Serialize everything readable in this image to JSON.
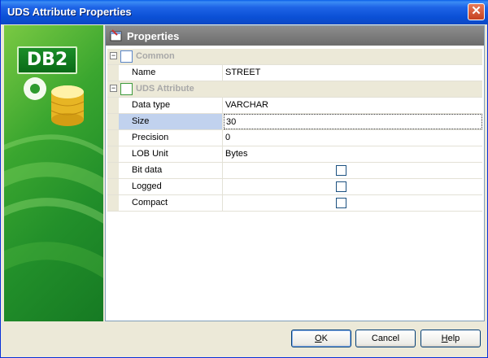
{
  "window": {
    "title": "UDS Attribute Properties",
    "close_glyph": "✕"
  },
  "side": {
    "logo_text": "DB2",
    "accent": "#3aa62f"
  },
  "panel": {
    "title": "Properties"
  },
  "grid": {
    "categories": [
      {
        "label": "Common",
        "expander": "−"
      },
      {
        "label": "UDS Attribute",
        "expander": "−"
      }
    ],
    "common": [
      {
        "name": "Name",
        "value": "STREET"
      }
    ],
    "uds": [
      {
        "name": "Data type",
        "value": "VARCHAR"
      },
      {
        "name": "Size",
        "value": "30"
      },
      {
        "name": "Precision",
        "value": "0"
      },
      {
        "name": "LOB Unit",
        "value": "Bytes"
      },
      {
        "name": "Bit data",
        "checked": false
      },
      {
        "name": "Logged",
        "checked": false
      },
      {
        "name": "Compact",
        "checked": false
      }
    ]
  },
  "buttons": {
    "ok": {
      "mnemonic": "O",
      "rest": "K"
    },
    "cancel": "Cancel",
    "help": {
      "mnemonic": "H",
      "rest": "elp"
    }
  }
}
